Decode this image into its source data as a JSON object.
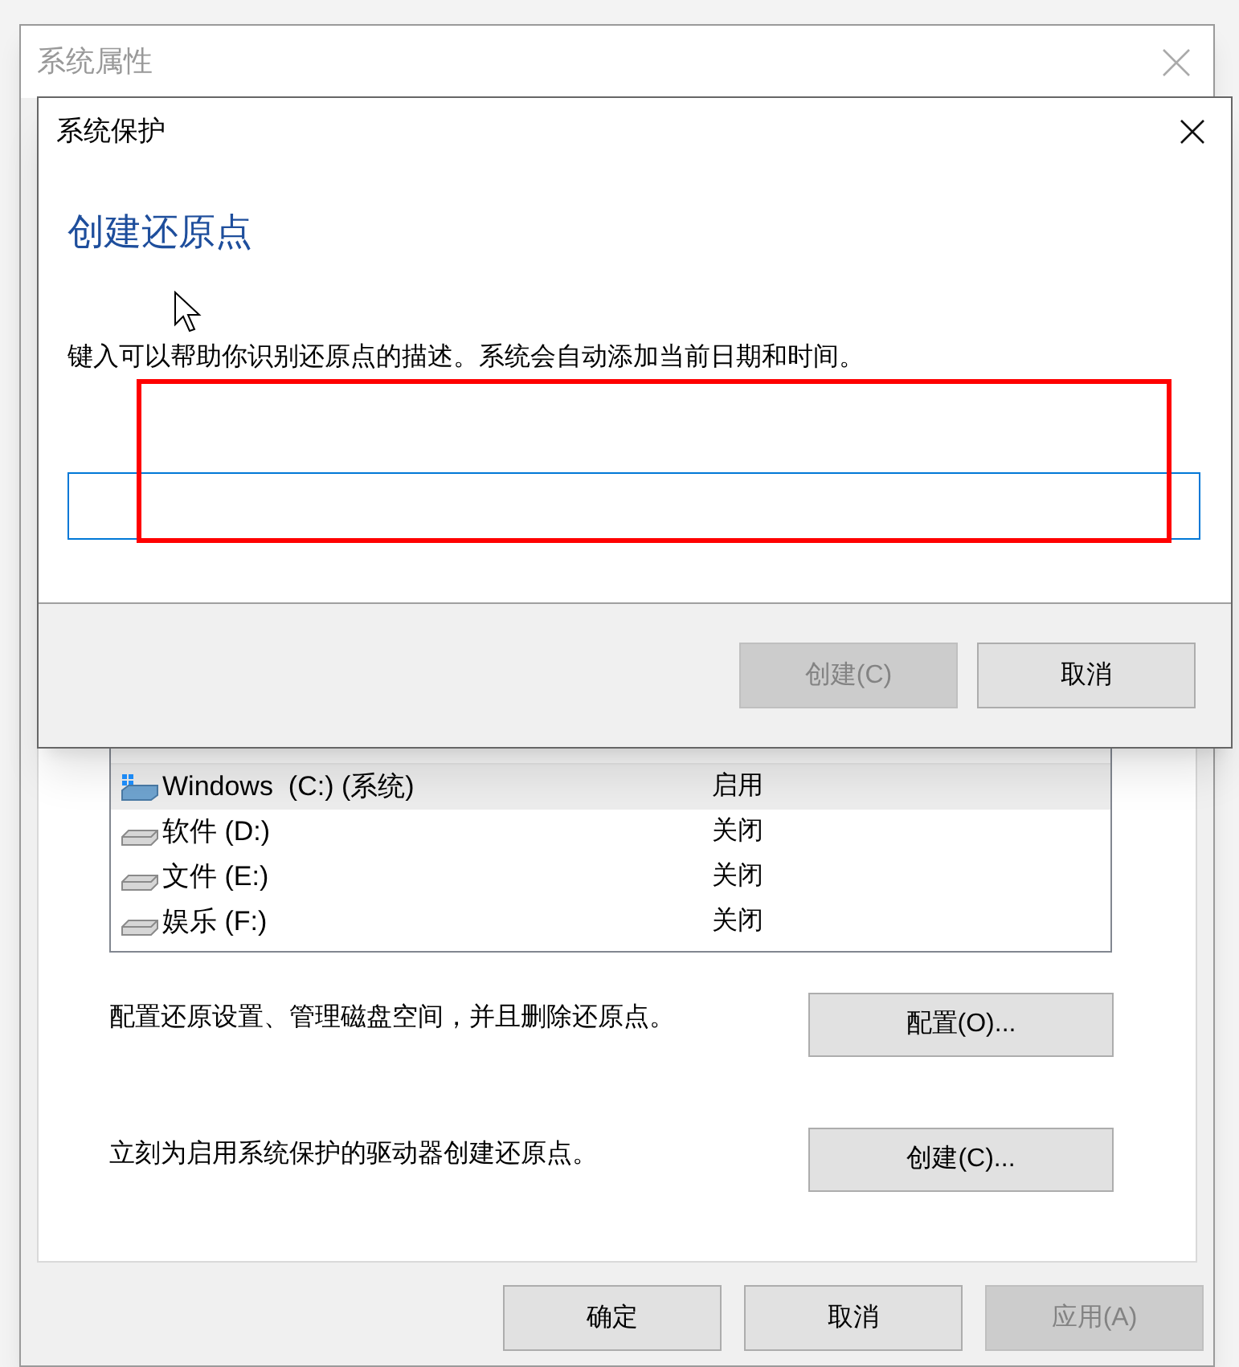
{
  "window": {
    "title": "系统属性"
  },
  "drives": {
    "rows": [
      {
        "name": "Windows  (C:) (系统)",
        "status": "启用",
        "kind": "system",
        "selected": true
      },
      {
        "name": "软件 (D:)",
        "status": "关闭",
        "kind": "disk",
        "selected": false
      },
      {
        "name": "文件 (E:)",
        "status": "关闭",
        "kind": "disk",
        "selected": false
      },
      {
        "name": "娱乐 (F:)",
        "status": "关闭",
        "kind": "disk",
        "selected": false
      }
    ]
  },
  "configure": {
    "text": "配置还原设置、管理磁盘空间，并且删除还原点。",
    "button": "配置(O)..."
  },
  "create": {
    "text": "立刻为启用系统保护的驱动器创建还原点。",
    "button": "创建(C)..."
  },
  "buttons": [
    {
      "label": "确定",
      "disabled": false
    },
    {
      "label": "取消",
      "disabled": false
    },
    {
      "label": "应用(A)",
      "disabled": true
    }
  ],
  "dialog": {
    "title": "系统保护",
    "heading": "创建还原点",
    "description": "键入可以帮助你识别还原点的描述。系统会自动添加当前日期和时间。",
    "input": {
      "focused": true
    },
    "buttons": [
      {
        "label": "创建(C)",
        "disabled": true
      },
      {
        "label": "取消",
        "disabled": false
      }
    ]
  },
  "annotation": {
    "kind": "highlight",
    "color": "#ff0000"
  }
}
